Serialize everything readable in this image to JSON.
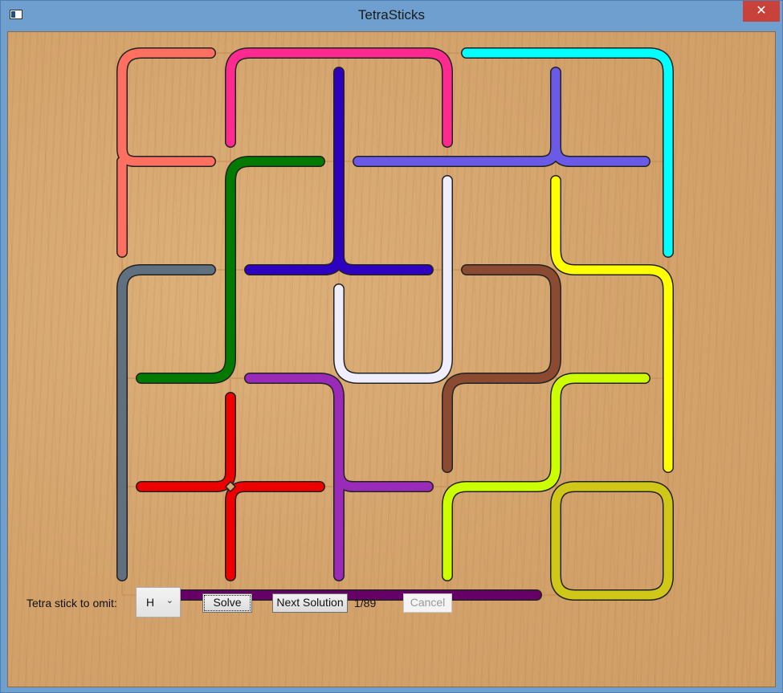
{
  "window": {
    "title": "TetraSticks",
    "close_glyph": "✕"
  },
  "controls": {
    "omit_label": "Tetra stick to omit:",
    "omit_value": "H",
    "dropdown_glyph": "⌄",
    "solve_label": "Solve",
    "next_label": "Next Solution",
    "solution_counter": "1/89",
    "cancel_label": "Cancel"
  },
  "colors": {
    "salmon": "#ff7060",
    "pink": "#ff2a8f",
    "cyan": "#00ffff",
    "indigo": "#2e00c0",
    "slate_blue": "#6a5ae6",
    "green": "#007a00",
    "lavender": "#eeeeff",
    "gray": "#607080",
    "brown": "#8b4a32",
    "yellow": "#ffff00",
    "purple": "#9a2ab8",
    "red": "#ee0000",
    "chartreuse": "#ccff00",
    "olive": "#d0c818",
    "dark_purple": "#660066"
  }
}
